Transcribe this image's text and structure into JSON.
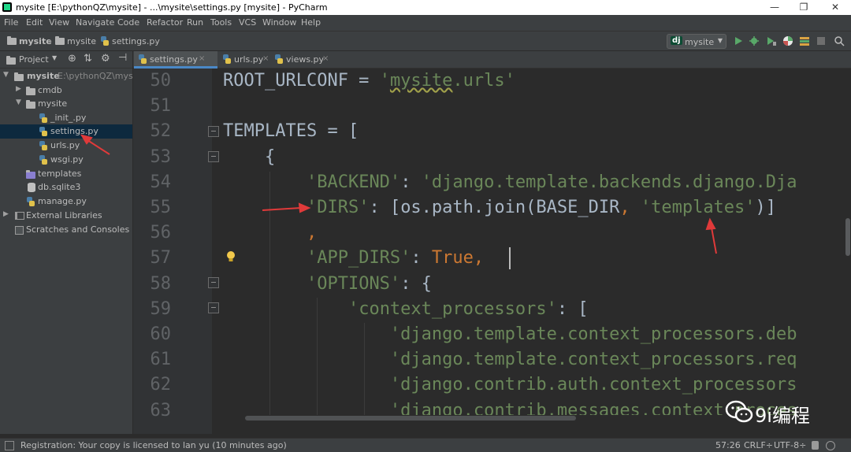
{
  "window": {
    "title": "mysite [E:\\pythonQZ\\mysite] - ...\\mysite\\settings.py [mysite] - PyCharm",
    "controls": [
      "—",
      "❐",
      "✕"
    ]
  },
  "menu": [
    "File",
    "Edit",
    "View",
    "Navigate",
    "Code",
    "Refactor",
    "Run",
    "Tools",
    "VCS",
    "Window",
    "Help"
  ],
  "breadcrumbs": [
    "mysite",
    "mysite",
    "settings.py"
  ],
  "run_config": {
    "badge": "dj",
    "label": "mysite"
  },
  "project_panel": {
    "header": "Project",
    "items": [
      {
        "label": "mysite",
        "extra": "E:\\pythonQZ\\mysite",
        "arrow": "▼",
        "icon": "folder-icon"
      },
      {
        "label": "cmdb",
        "arrow": "▶",
        "icon": "folder-icon"
      },
      {
        "label": "mysite",
        "arrow": "▼",
        "icon": "folder-icon"
      },
      {
        "label": "_init_.py",
        "icon": "python-file-icon"
      },
      {
        "label": "settings.py",
        "icon": "python-file-icon",
        "selected": true
      },
      {
        "label": "urls.py",
        "icon": "python-file-icon"
      },
      {
        "label": "wsgi.py",
        "icon": "python-file-icon"
      },
      {
        "label": "templates",
        "icon": "folder-icon"
      },
      {
        "label": "db.sqlite3",
        "icon": "database-icon"
      },
      {
        "label": "manage.py",
        "icon": "python-file-icon"
      },
      {
        "label": "External Libraries",
        "arrow": "▶",
        "icon": "library-icon"
      },
      {
        "label": "Scratches and Consoles",
        "icon": "scratch-icon"
      }
    ]
  },
  "tabs": [
    {
      "label": "settings.py",
      "close": "×",
      "active": true
    },
    {
      "label": "urls.py",
      "close": "×"
    },
    {
      "label": "views.py",
      "close": "×"
    }
  ],
  "code": {
    "lines": [
      {
        "no": "50",
        "t": [
          [
            "n",
            "ROOT_URLCONF = "
          ],
          [
            "s",
            "'"
          ],
          [
            "su",
            "mysite"
          ],
          [
            "s",
            ".urls'"
          ]
        ]
      },
      {
        "no": "51",
        "t": []
      },
      {
        "no": "52",
        "t": [
          [
            "n",
            "TEMPLATES = ["
          ]
        ]
      },
      {
        "no": "53",
        "t": [
          [
            "n",
            "    {"
          ]
        ]
      },
      {
        "no": "54",
        "t": [
          [
            "n",
            "        "
          ],
          [
            "s",
            "'BACKEND'"
          ],
          [
            "n",
            ": "
          ],
          [
            "s",
            "'django.template.backends.django.Dja"
          ]
        ]
      },
      {
        "no": "55",
        "t": [
          [
            "n",
            "        "
          ],
          [
            "s",
            "'DIRS'"
          ],
          [
            "n",
            ": [os.path.join(BASE_DIR"
          ],
          [
            "k",
            ", "
          ],
          [
            "s",
            "'templates'"
          ],
          [
            "n",
            ")]"
          ]
        ]
      },
      {
        "no": "56",
        "t": [
          [
            "n",
            "        "
          ],
          [
            "k",
            ","
          ]
        ]
      },
      {
        "no": "57",
        "t": [
          [
            "n",
            "        "
          ],
          [
            "s",
            "'APP_DIRS'"
          ],
          [
            "n",
            ": "
          ],
          [
            "k",
            "True,"
          ]
        ]
      },
      {
        "no": "58",
        "t": [
          [
            "n",
            "        "
          ],
          [
            "s",
            "'OPTIONS'"
          ],
          [
            "n",
            ": {"
          ]
        ]
      },
      {
        "no": "59",
        "t": [
          [
            "n",
            "            "
          ],
          [
            "s",
            "'context_processors'"
          ],
          [
            "n",
            ": ["
          ]
        ]
      },
      {
        "no": "60",
        "t": [
          [
            "n",
            "                "
          ],
          [
            "s",
            "'django.template.context_processors.deb"
          ]
        ]
      },
      {
        "no": "61",
        "t": [
          [
            "n",
            "                "
          ],
          [
            "s",
            "'django.template.context_processors.req"
          ]
        ]
      },
      {
        "no": "62",
        "t": [
          [
            "n",
            "                "
          ],
          [
            "s",
            "'django.contrib.auth.context_processors"
          ]
        ]
      },
      {
        "no": "63",
        "t": [
          [
            "n",
            "                "
          ],
          [
            "s",
            "'django.contrib.messages.context_proces"
          ]
        ]
      }
    ]
  },
  "status": {
    "message": "Registration: Your copy is licensed to lan yu (10 minutes ago)",
    "position": "57:26",
    "line_sep": "CRLF÷",
    "encoding": "UTF-8÷"
  },
  "watermark": {
    "text": "9i编程"
  },
  "colors": {
    "keyword": "#cc7832",
    "string": "#6a8759",
    "text": "#a9b7c6",
    "annotation_arrow": "#e03a3a"
  }
}
